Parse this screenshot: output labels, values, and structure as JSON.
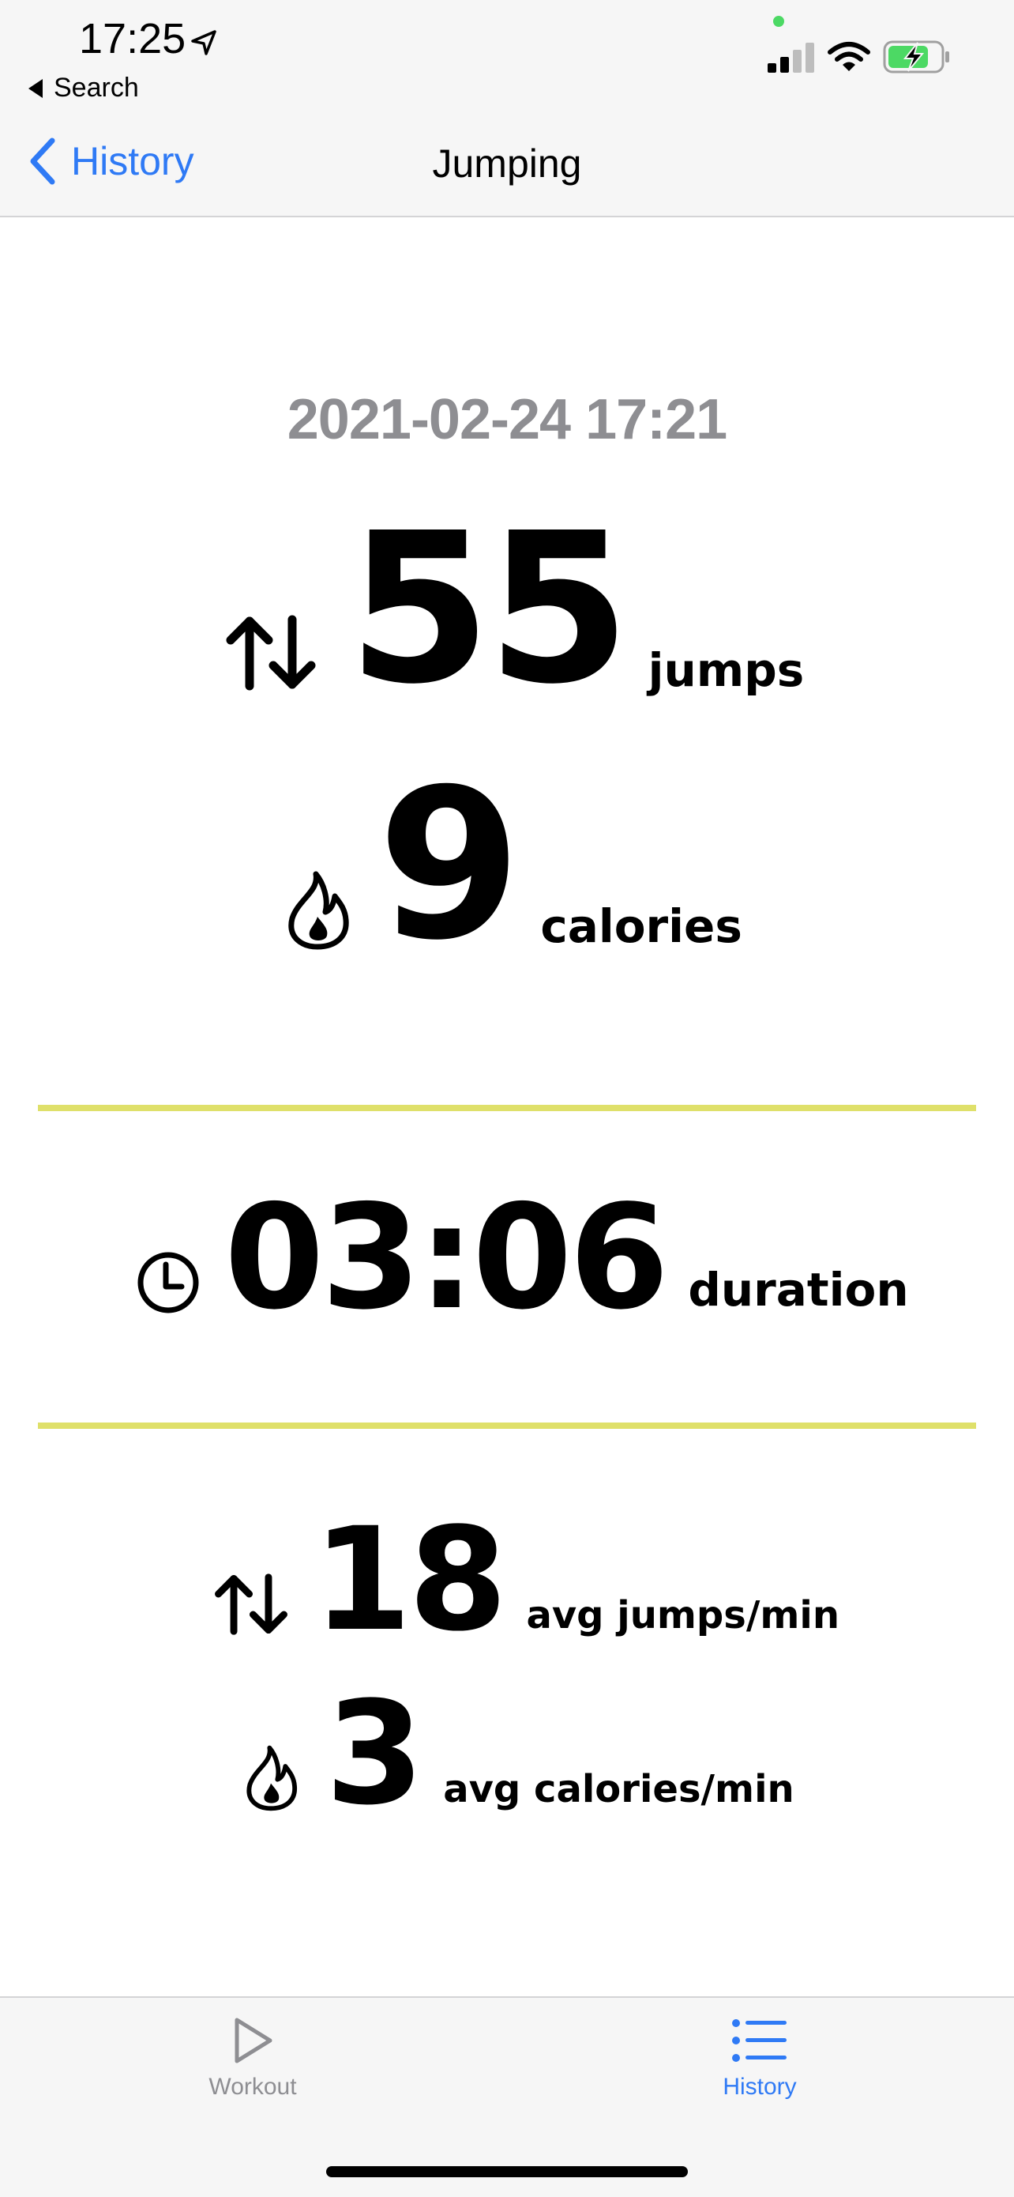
{
  "status_bar": {
    "time": "17:25",
    "back_app_label": "Search"
  },
  "nav": {
    "back_label": "History",
    "title": "Jumping"
  },
  "workout": {
    "date": "2021-02-24 17:21",
    "jumps": {
      "value": "55",
      "unit": "jumps"
    },
    "calories": {
      "value": "9",
      "unit": "calories"
    },
    "duration": {
      "value": "03:06",
      "unit": "duration"
    },
    "avg_jumps": {
      "value": "18",
      "unit": "avg jumps/min"
    },
    "avg_calories": {
      "value": "3",
      "unit": "avg calories/min"
    }
  },
  "tabs": [
    {
      "label": "Workout",
      "icon": "play-icon",
      "selected": false
    },
    {
      "label": "History",
      "icon": "list-icon",
      "selected": true
    }
  ],
  "colors": {
    "accent": "#2f7af5",
    "divider": "#dfe06a",
    "date_gray": "#8e8e92",
    "battery_green": "#4cd964"
  }
}
